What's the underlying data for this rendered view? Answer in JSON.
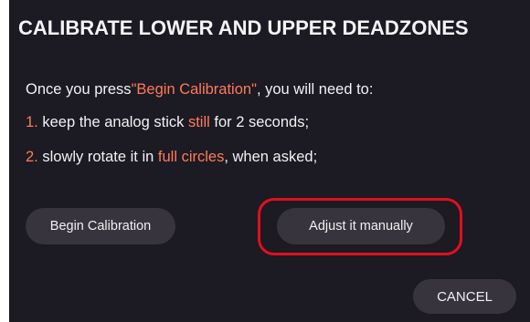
{
  "dialog": {
    "title": "CALIBRATE LOWER AND UPPER DEADZONES",
    "intro_prefix": "Once you press",
    "intro_quoted": "\"Begin Calibration\"",
    "intro_suffix": ", you will need to:",
    "step1": {
      "number": "1.",
      "text_before": " keep the analog stick ",
      "highlight": "still",
      "text_after": " for 2 seconds;"
    },
    "step2": {
      "number": "2.",
      "text_before": " slowly rotate it in ",
      "highlight": "full circles",
      "text_after": ", when asked;"
    },
    "buttons": {
      "begin": "Begin Calibration",
      "adjust": "Adjust it manually",
      "cancel": "CANCEL"
    }
  },
  "colors": {
    "background": "#1c1a22",
    "button": "#37343e",
    "accent": "#ff7a5c",
    "annotation": "#e0101e"
  }
}
